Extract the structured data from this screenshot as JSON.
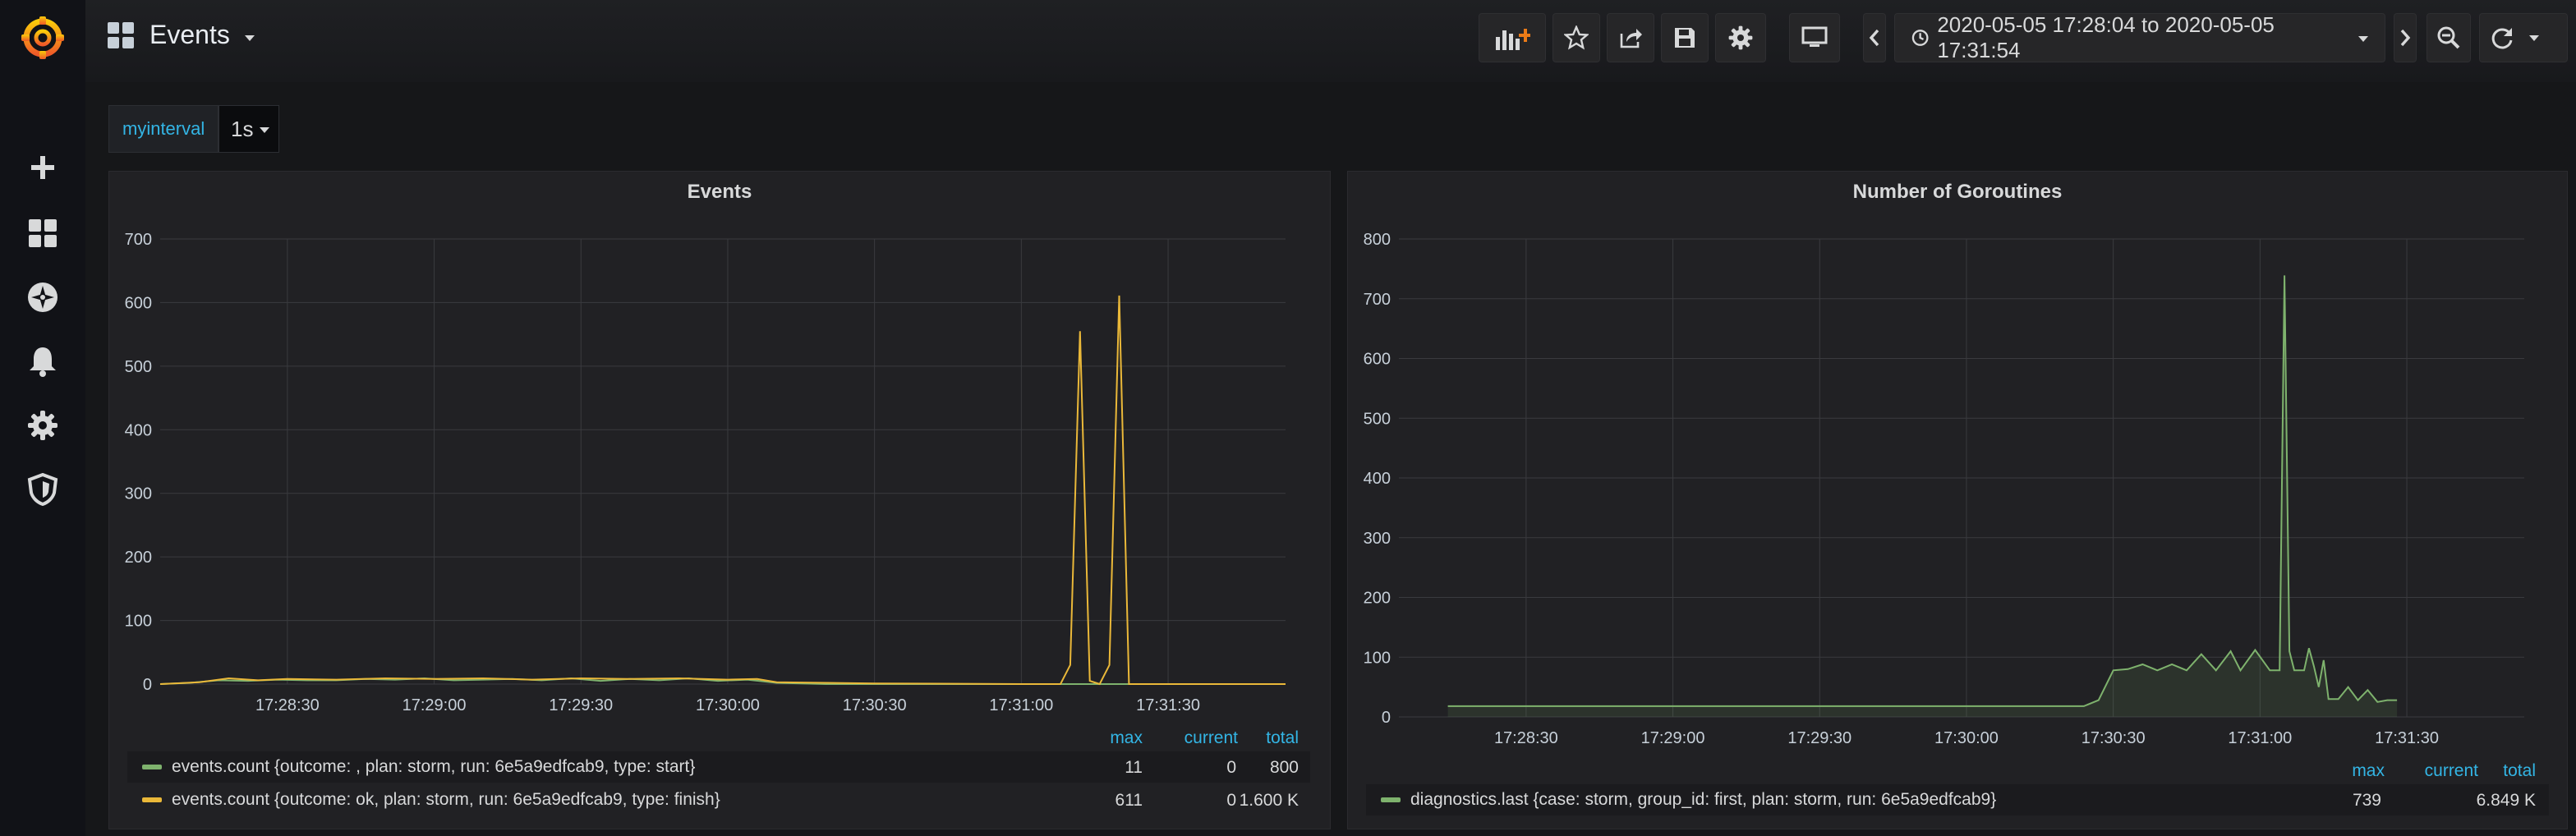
{
  "app": {
    "dashboard_title": "Events",
    "time_range": "2020-05-05 17:28:04 to 2020-05-05 17:31:54",
    "variable": {
      "label": "myinterval",
      "value": "1s"
    },
    "icons": {
      "logo": "grafana-logo-icon",
      "sidebar": [
        "plus-icon",
        "dashboards-icon",
        "explore-compass-icon",
        "alerting-bell-icon",
        "configuration-gear-icon",
        "shield-icon"
      ],
      "toolbar": [
        "add-panel-icon",
        "star-icon",
        "share-icon",
        "save-icon",
        "settings-gear-icon",
        "tv-mode-icon",
        "time-back-icon",
        "clock-icon",
        "time-forward-icon",
        "zoom-out-icon",
        "refresh-icon",
        "refresh-dropdown-icon"
      ]
    },
    "colors": {
      "accent_blue": "#33b5e5",
      "series_green": "#7eb26d",
      "series_yellow": "#eab839"
    }
  },
  "panels": [
    {
      "title": "Events",
      "legend": {
        "headers": {
          "max": "max",
          "current": "current",
          "total": "total"
        },
        "rows": [
          {
            "name": "events.count {outcome: , plan: storm, run: 6e5a9edfcab9, type: start}",
            "max": "11",
            "current": "0",
            "total": "800"
          },
          {
            "name": "events.count {outcome: ok, plan: storm, run: 6e5a9edfcab9, type: finish}",
            "max": "611",
            "current": "0",
            "total": "1.600 K"
          }
        ]
      }
    },
    {
      "title": "Number of Goroutines",
      "legend": {
        "headers": {
          "max": "max",
          "current": "current",
          "total": "total"
        },
        "rows": [
          {
            "name": "diagnostics.last {case: storm, group_id: first, plan: storm, run: 6e5a9edfcab9}",
            "max": "739",
            "current": "",
            "total": "6.849 K"
          }
        ]
      }
    }
  ],
  "chart_data": [
    {
      "type": "line",
      "title": "Events",
      "ylim": [
        0,
        700
      ],
      "yticks": [
        "0",
        "100",
        "200",
        "300",
        "400",
        "500",
        "600",
        "700"
      ],
      "xticks": [
        "17:28:30",
        "17:29:00",
        "17:29:30",
        "17:30:00",
        "17:30:30",
        "17:31:00",
        "17:31:30"
      ],
      "xlim": [
        "17:28:04",
        "17:31:54"
      ],
      "grid": true,
      "series": [
        {
          "name": "events.count {outcome: , plan: storm, run: 6e5a9edfcab9, type: start}",
          "color": "#7eb26d",
          "x": [
            "17:28:04",
            "17:28:10",
            "17:28:16",
            "17:28:22",
            "17:28:28",
            "17:28:34",
            "17:28:40",
            "17:28:46",
            "17:28:52",
            "17:28:58",
            "17:29:04",
            "17:29:10",
            "17:29:16",
            "17:29:22",
            "17:29:28",
            "17:29:34",
            "17:29:40",
            "17:29:46",
            "17:29:52",
            "17:29:58",
            "17:30:04",
            "17:30:10",
            "17:30:20",
            "17:30:40",
            "17:31:00",
            "17:31:20",
            "17:31:40",
            "17:31:54"
          ],
          "y": [
            0,
            2,
            6,
            5,
            7,
            6,
            6,
            8,
            7,
            9,
            6,
            7,
            8,
            6,
            9,
            5,
            8,
            6,
            9,
            5,
            7,
            2,
            0,
            0,
            0,
            0,
            0,
            0
          ]
        },
        {
          "name": "events.count {outcome: ok, plan: storm, run: 6e5a9edfcab9, type: finish}",
          "color": "#eab839",
          "x": [
            "17:28:04",
            "17:28:12",
            "17:28:18",
            "17:28:24",
            "17:28:30",
            "17:28:40",
            "17:28:50",
            "17:29:00",
            "17:29:10",
            "17:29:20",
            "17:29:30",
            "17:29:40",
            "17:29:50",
            "17:30:00",
            "17:30:06",
            "17:30:10",
            "17:30:30",
            "17:31:00",
            "17:31:08",
            "17:31:10",
            "17:31:12",
            "17:31:14",
            "17:31:16",
            "17:31:18",
            "17:31:20",
            "17:31:22",
            "17:31:54"
          ],
          "y": [
            0,
            3,
            9,
            6,
            8,
            7,
            9,
            8,
            9,
            7,
            9,
            8,
            9,
            7,
            8,
            3,
            1,
            0,
            0,
            30,
            555,
            5,
            0,
            30,
            611,
            0,
            0
          ]
        }
      ]
    },
    {
      "type": "area",
      "title": "Number of Goroutines",
      "ylim": [
        0,
        800
      ],
      "yticks": [
        "0",
        "100",
        "200",
        "300",
        "400",
        "500",
        "600",
        "700",
        "800"
      ],
      "xticks": [
        "17:28:30",
        "17:29:00",
        "17:29:30",
        "17:30:00",
        "17:30:30",
        "17:31:00",
        "17:31:30"
      ],
      "xlim": [
        "17:28:04",
        "17:31:54"
      ],
      "grid": true,
      "series": [
        {
          "name": "diagnostics.last {case: storm, group_id: first, plan: storm, run: 6e5a9edfcab9}",
          "color": "#7eb26d",
          "x": [
            "17:28:14",
            "17:30:24",
            "17:30:27",
            "17:30:30",
            "17:30:33",
            "17:30:36",
            "17:30:39",
            "17:30:42",
            "17:30:45",
            "17:30:48",
            "17:30:51",
            "17:30:54",
            "17:30:56",
            "17:30:59",
            "17:31:02",
            "17:31:04",
            "17:31:05",
            "17:31:06",
            "17:31:07",
            "17:31:09",
            "17:31:10",
            "17:31:11",
            "17:31:12",
            "17:31:13",
            "17:31:14",
            "17:31:15",
            "17:31:16",
            "17:31:18",
            "17:31:20",
            "17:31:22",
            "17:31:24",
            "17:31:26",
            "17:31:28"
          ],
          "y": [
            18,
            18,
            28,
            78,
            80,
            88,
            78,
            88,
            78,
            105,
            78,
            110,
            78,
            112,
            78,
            78,
            739,
            110,
            78,
            78,
            115,
            85,
            50,
            95,
            30,
            30,
            30,
            50,
            28,
            45,
            25,
            28,
            28
          ]
        }
      ]
    }
  ]
}
